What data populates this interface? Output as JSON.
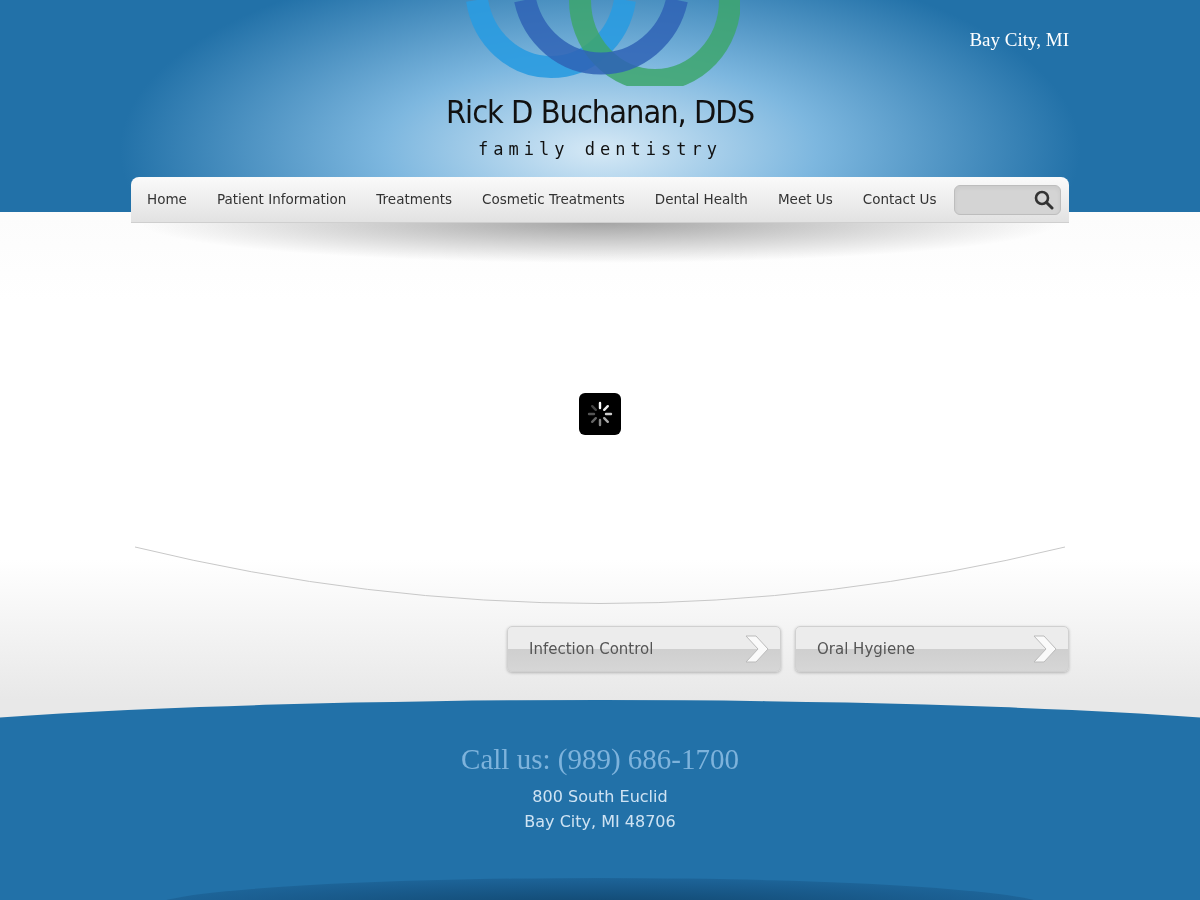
{
  "header": {
    "location": "Bay City, MI",
    "logo_name": "Rick D Buchanan, DDS",
    "logo_tagline": "family dentistry"
  },
  "nav": {
    "items": [
      "Home",
      "Patient Information",
      "Treatments",
      "Cosmetic Treatments",
      "Dental Health",
      "Meet Us",
      "Contact Us"
    ]
  },
  "features": [
    "Infection Control",
    "Oral Hygiene"
  ],
  "footer": {
    "phone": "Call us: (989) 686-1700",
    "address": [
      "800 South Euclid",
      "Bay City, MI 48706"
    ]
  }
}
